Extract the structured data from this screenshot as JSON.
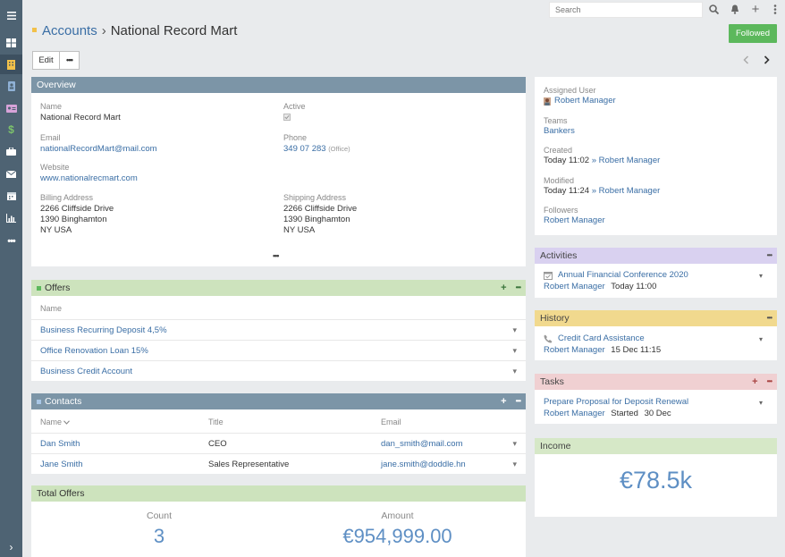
{
  "topbar": {
    "search_placeholder": "Search"
  },
  "header": {
    "module": "Accounts",
    "separator": "›",
    "record": "National Record Mart",
    "followed_label": "Followed",
    "edit_label": "Edit",
    "more_label": "•••"
  },
  "overview": {
    "title": "Overview",
    "name_label": "Name",
    "name_value": "National Record Mart",
    "active_label": "Active",
    "email_label": "Email",
    "email_value": "nationalRecordMart@mail.com",
    "phone_label": "Phone",
    "phone_value": "349 07 283",
    "phone_type": "(Office)",
    "website_label": "Website",
    "website_value": "www.nationalrecmart.com",
    "billing_label": "Billing Address",
    "billing_lines": [
      "2266 Cliffside Drive",
      "1390 Binghamton",
      "NY USA"
    ],
    "shipping_label": "Shipping Address",
    "shipping_lines": [
      "2266 Cliffside Drive",
      "1390 Binghamton",
      "NY USA"
    ],
    "more_label": "•••"
  },
  "offers": {
    "title": "Offers",
    "column": "Name",
    "rows": [
      "Business Recurring Deposit 4,5%",
      "Office Renovation Loan 15%",
      "Business Credit Account"
    ]
  },
  "contacts": {
    "title": "Contacts",
    "columns": [
      "Name",
      "Title",
      "Email"
    ],
    "rows": [
      {
        "name": "Dan Smith",
        "title": "CEO",
        "email": "dan_smith@mail.com"
      },
      {
        "name": "Jane Smith",
        "title": "Sales Representative",
        "email": "jane.smith@doddle.hn"
      }
    ]
  },
  "total_offers": {
    "title": "Total Offers",
    "count_label": "Count",
    "count_value": "3",
    "amount_label": "Amount",
    "amount_value": "€954,999.00"
  },
  "side": {
    "assigned_label": "Assigned User",
    "assigned_value": "Robert Manager",
    "teams_label": "Teams",
    "teams_value": "Bankers",
    "created_label": "Created",
    "created_date": "Today 11:02",
    "created_by": "Robert Manager",
    "modified_label": "Modified",
    "modified_date": "Today 11:24",
    "modified_by": "Robert Manager",
    "followers_label": "Followers",
    "followers_value": "Robert Manager",
    "by_sep": "»"
  },
  "activities": {
    "title": "Activities",
    "item_title": "Annual Financial Conference 2020",
    "item_user": "Robert Manager",
    "item_time": "Today 11:00"
  },
  "history": {
    "title": "History",
    "item_title": "Credit Card Assistance",
    "item_user": "Robert Manager",
    "item_time": "15 Dec 11:15"
  },
  "tasks": {
    "title": "Tasks",
    "item_title": "Prepare Proposal for Deposit Renewal",
    "item_user": "Robert Manager",
    "item_status": "Started",
    "item_date": "30 Dec"
  },
  "income": {
    "title": "Income",
    "value": "€78.5k"
  },
  "colors": {
    "sidebar": "#4e6373",
    "accent_link": "#3a6ea5",
    "followed": "#5cb85c",
    "panel_blue": "#7c95a7",
    "panel_green": "#cde3bd",
    "big_number": "#5e8fc4"
  }
}
